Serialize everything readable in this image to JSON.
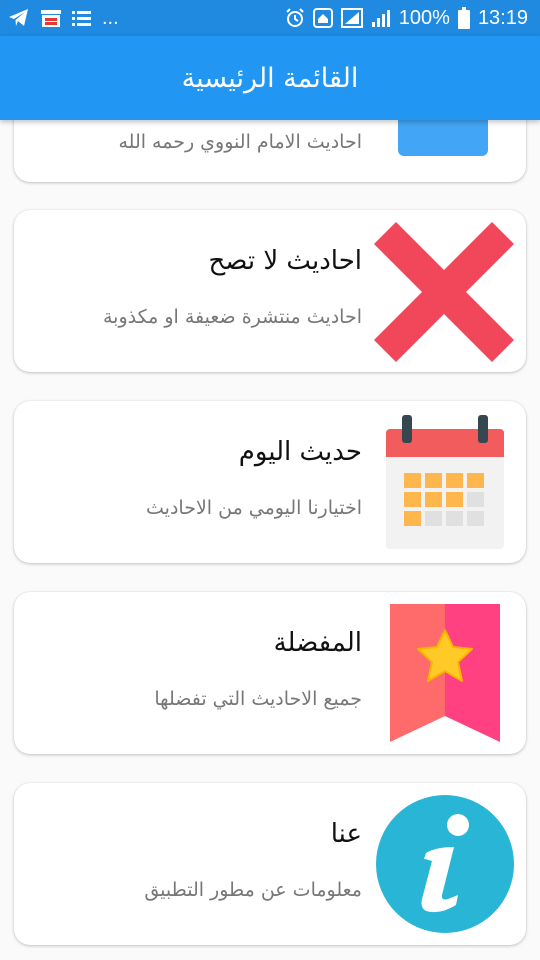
{
  "status_bar": {
    "left_icons": [
      "telegram-icon",
      "store-icon",
      "list-icon"
    ],
    "ellipsis": "...",
    "right_icons": [
      "alarm-icon",
      "home-icon",
      "signal-icon",
      "signal-icon-2",
      "battery-icon"
    ],
    "battery": "100%",
    "time": "13:19"
  },
  "app_bar": {
    "title": "القائمة الرئيسية"
  },
  "menu": {
    "items": [
      {
        "title": "",
        "subtitle": "احاديث الامام النووي رحمه الله",
        "icon": "book-icon",
        "color": "#42a5f5"
      },
      {
        "title": "احاديث لا تصح",
        "subtitle": "احاديث منتشرة ضعيفة او مكذوبة",
        "icon": "cross-icon",
        "color": "#f2475a"
      },
      {
        "title": "حديث اليوم",
        "subtitle": "اختيارنا اليومي من الاحاديث",
        "icon": "calendar-icon",
        "color": "#f25c5c"
      },
      {
        "title": "المفضلة",
        "subtitle": "جميع الاحاديث التي تفضلها",
        "icon": "bookmark-star-icon",
        "color": "#ff4081"
      },
      {
        "title": "عنا",
        "subtitle": "معلومات عن مطور التطبيق",
        "icon": "info-icon",
        "color": "#29b6d6"
      }
    ]
  }
}
